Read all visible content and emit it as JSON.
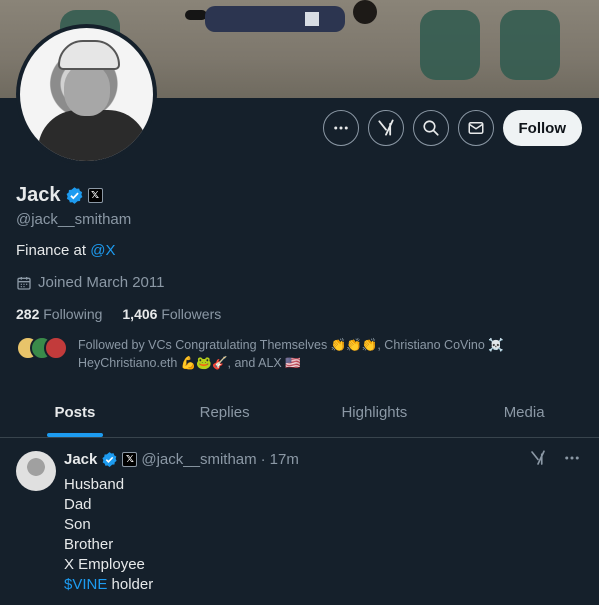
{
  "profile": {
    "name": "Jack",
    "handle": "@jack__smitham",
    "bio_prefix": "Finance at ",
    "bio_link": "@X",
    "joined": "Joined March 2011",
    "following_count": "282",
    "following_label": "Following",
    "followers_count": "1,406",
    "followers_label": "Followers",
    "followed_by": "Followed by VCs Congratulating Themselves 👏👏👏, Christiano CoVino ☠️ HeyChristiano.eth 💪🐸🎸, and ALX 🇺🇸"
  },
  "actions": {
    "follow_label": "Follow"
  },
  "tabs": [
    {
      "label": "Posts"
    },
    {
      "label": "Replies"
    },
    {
      "label": "Highlights"
    },
    {
      "label": "Media"
    }
  ],
  "post": {
    "name": "Jack",
    "handle": "@jack__smitham",
    "separator": "·",
    "time": "17m",
    "lines": [
      "Husband",
      "Dad",
      "Son",
      "Brother",
      "X Employee"
    ],
    "cashtag": "$VINE",
    "last_suffix": " holder"
  },
  "colors": {
    "background": "#15202b",
    "accent": "#1d9bf0",
    "secondary_text": "#8b98a5",
    "verified": "#1d9bf0"
  },
  "icons": [
    "more-icon",
    "grok-icon",
    "search-icon",
    "message-icon",
    "verified-badge-icon",
    "x-affiliate-icon",
    "calendar-icon"
  ]
}
